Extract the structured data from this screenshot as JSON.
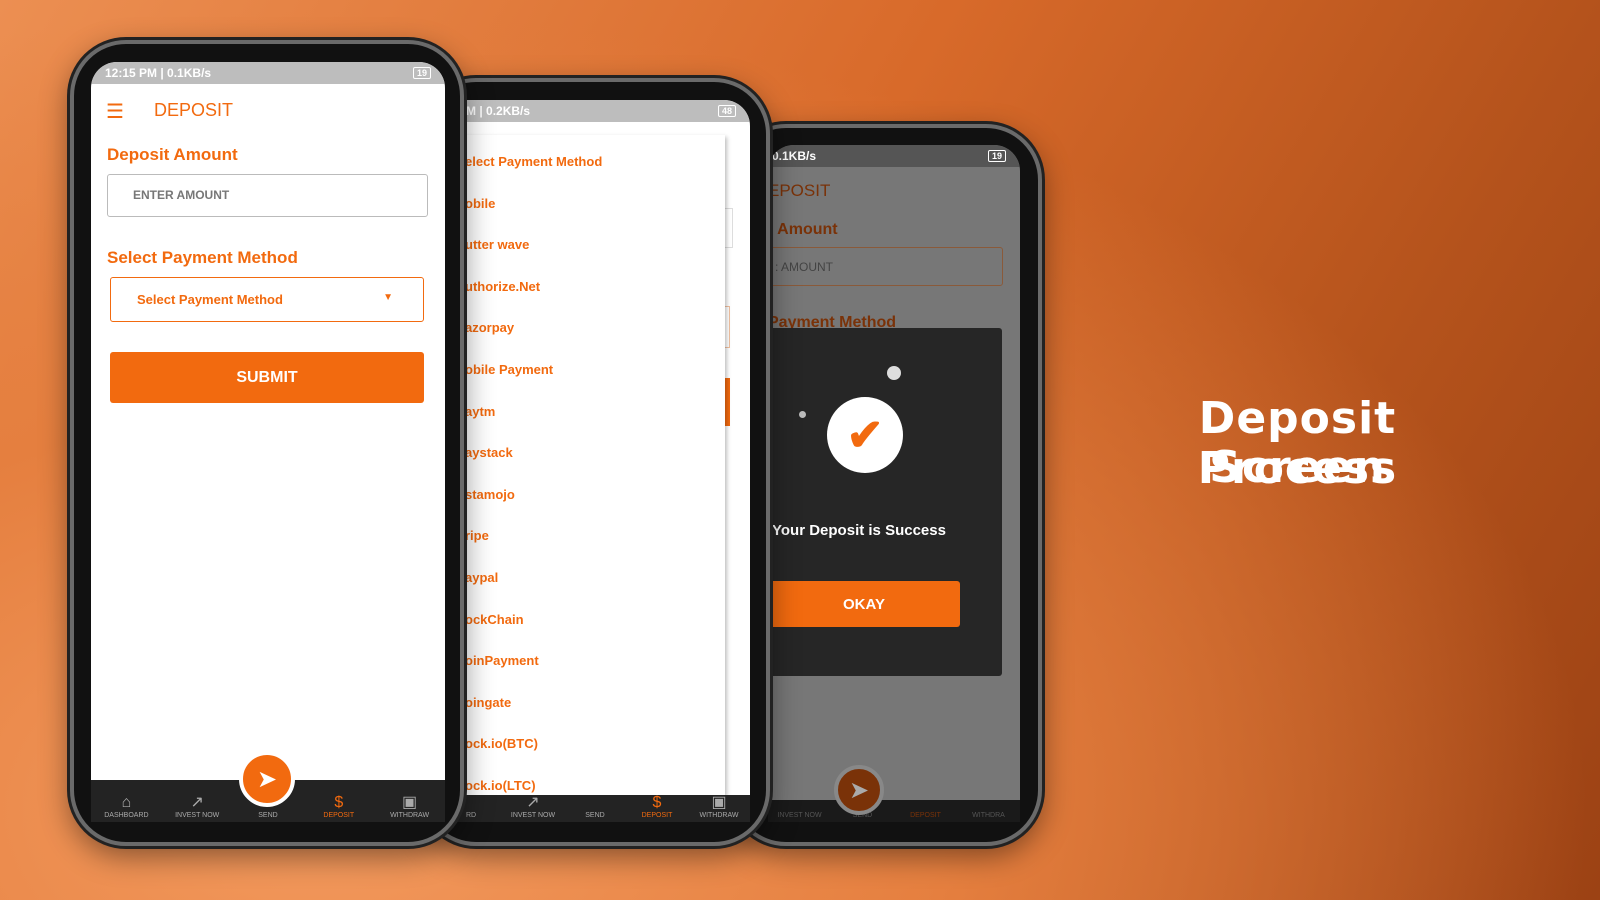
{
  "headline": {
    "line1": "Deposit Process",
    "line2": "Screen"
  },
  "colors": {
    "accent": "#f26a0f",
    "nav_bg": "#232323",
    "dialog_bg": "#262626"
  },
  "phone1": {
    "status_left": "12:15 PM | 0.1KB/s",
    "battery": "19",
    "header_title": "DEPOSIT",
    "menu_icon": "hamburger-icon",
    "amount_label": "Deposit Amount",
    "amount_placeholder": "ENTER AMOUNT",
    "method_label": "Select Payment Method",
    "method_selected": "Select Payment Method",
    "submit": "SUBMIT",
    "nav": [
      {
        "label": "DASHBOARD",
        "icon": "home-icon"
      },
      {
        "label": "INVEST NOW",
        "icon": "trend-icon"
      },
      {
        "label": "SEND",
        "icon": "send-icon"
      },
      {
        "label": "DEPOSIT",
        "icon": "dollar-icon",
        "active": true
      },
      {
        "label": "WITHDRAW",
        "icon": "wallet-icon"
      }
    ]
  },
  "phone2": {
    "status_left": "M | 0.2KB/s",
    "battery": "48",
    "options": [
      "elect Payment Method",
      "obile",
      "utter wave",
      "uthorize.Net",
      "azorpay",
      "obile Payment",
      "aytm",
      "aystack",
      "stamojo",
      "ripe",
      "aypal",
      "ockChain",
      "oinPayment",
      "oingate",
      "ock.io(BTC)",
      "ock.io(LTC)"
    ],
    "nav": [
      "RD",
      "INVEST NOW",
      "SEND",
      "DEPOSIT",
      "WITHDRAW"
    ]
  },
  "phone3": {
    "status_left": "0.1KB/s",
    "battery": "19",
    "header_title": "EPOSIT",
    "amount_label": ": Amount",
    "amount_placeholder": ": AMOUNT",
    "method_label": "Payment Method",
    "dialog_message": "Your Deposit is Success",
    "dialog_button": "OKAY",
    "nav": [
      "INVEST NOW",
      "SEND",
      "DEPOSIT",
      "WITHDRA"
    ]
  }
}
